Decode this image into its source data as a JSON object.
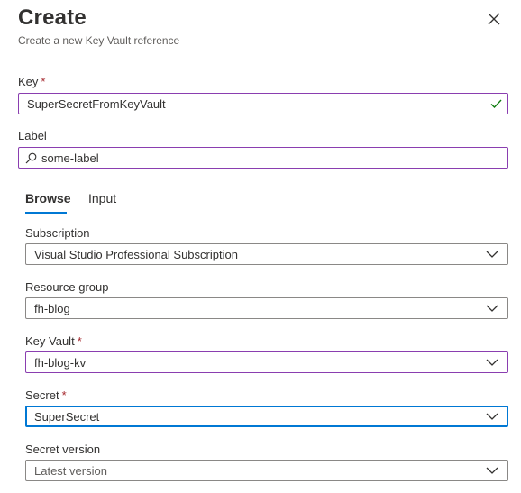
{
  "header": {
    "title": "Create",
    "subtitle": "Create a new Key Vault reference"
  },
  "form": {
    "key": {
      "label": "Key",
      "required_mark": "*",
      "value": "SuperSecretFromKeyVault",
      "status_icon": "checkmark-icon"
    },
    "label_field": {
      "label": "Label",
      "value": "some-label",
      "icon": "search-icon"
    },
    "tabs": [
      {
        "label": "Browse",
        "active": true
      },
      {
        "label": "Input",
        "active": false
      }
    ],
    "subscription": {
      "label": "Subscription",
      "value": "Visual Studio Professional Subscription"
    },
    "resource_group": {
      "label": "Resource group",
      "value": "fh-blog"
    },
    "key_vault": {
      "label": "Key Vault",
      "required_mark": "*",
      "value": "fh-blog-kv"
    },
    "secret": {
      "label": "Secret",
      "required_mark": "*",
      "value": "SuperSecret"
    },
    "secret_version": {
      "label": "Secret version",
      "value": "Latest version"
    }
  },
  "colors": {
    "accent": "#0078d4",
    "required": "#a4262c",
    "valid_check": "#107c10",
    "validated_border": "#8a3eb0"
  }
}
